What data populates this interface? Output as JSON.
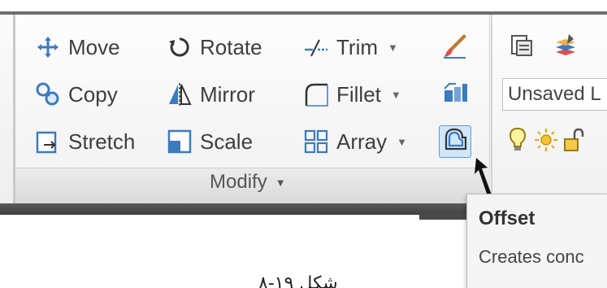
{
  "modify_panel": {
    "title": "Modify",
    "tools": [
      {
        "label": "Move",
        "icon": "move-icon"
      },
      {
        "label": "Copy",
        "icon": "copy-icon"
      },
      {
        "label": "Stretch",
        "icon": "stretch-icon"
      },
      {
        "label": "Rotate",
        "icon": "rotate-icon"
      },
      {
        "label": "Mirror",
        "icon": "mirror-icon"
      },
      {
        "label": "Scale",
        "icon": "scale-icon"
      },
      {
        "label": "Trim",
        "icon": "trim-icon"
      },
      {
        "label": "Fillet",
        "icon": "fillet-icon"
      },
      {
        "label": "Array",
        "icon": "array-icon"
      }
    ],
    "square_buttons": [
      "erase-icon",
      "explode-icon",
      "offset-icon"
    ]
  },
  "layers_panel": {
    "layer_state": "Unsaved L"
  },
  "tooltip": {
    "title": "Offset",
    "description": "Creates conc"
  },
  "caption": "شکل ۱۹-۸",
  "colors": {
    "active_button_bg": "#cfe6fb",
    "active_button_border": "#5d9be0",
    "bar_dark": "#4a4a4a"
  }
}
